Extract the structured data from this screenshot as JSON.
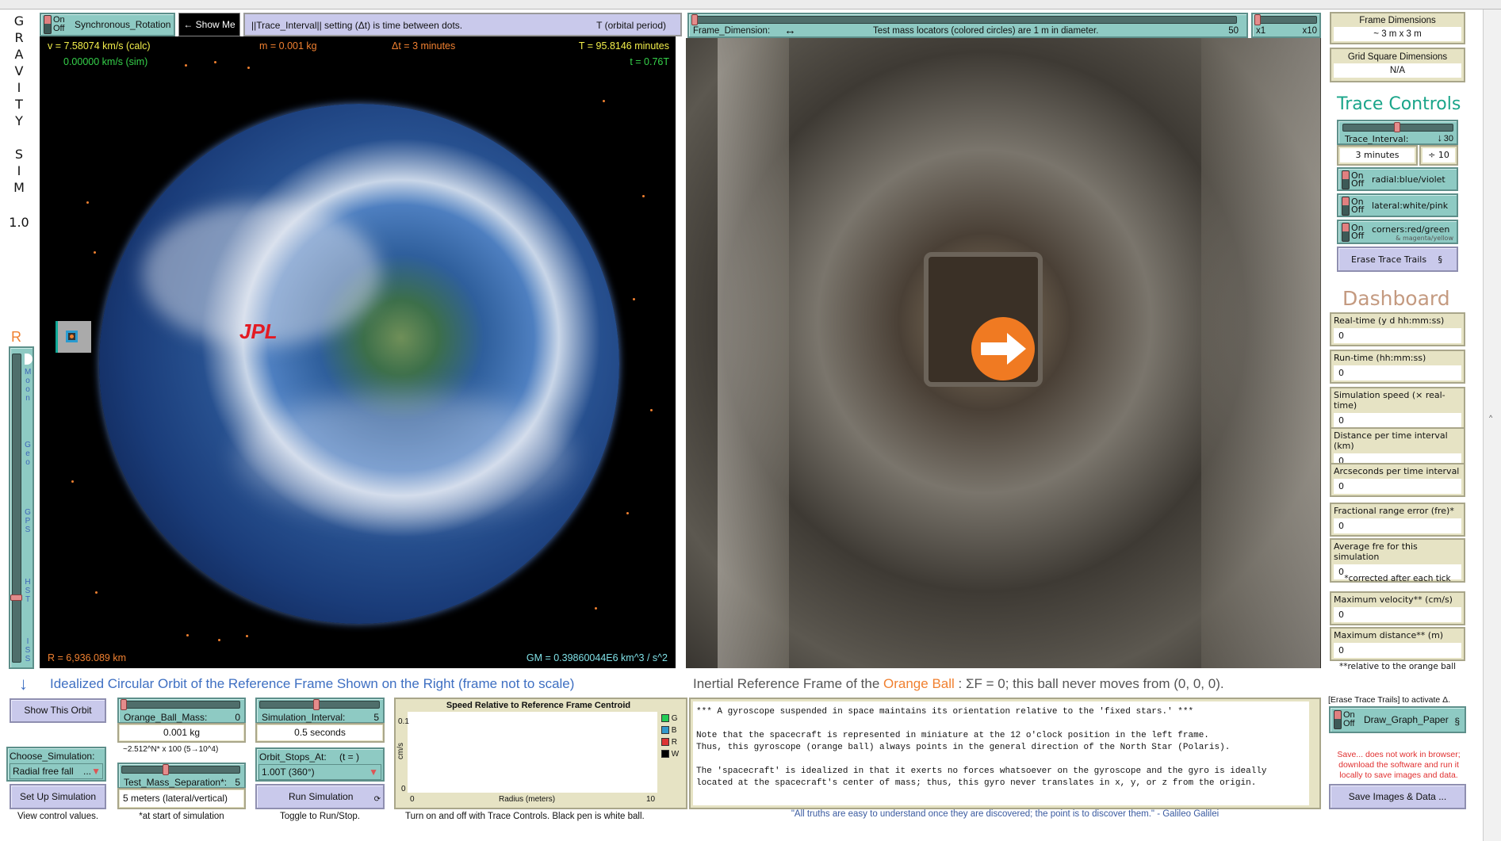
{
  "app_title_letters": [
    "G",
    "R",
    "A",
    "V",
    "I",
    "T",
    "Y",
    "S",
    "I",
    "M"
  ],
  "version": "1.0",
  "radius_label": "R",
  "orbit_slider": {
    "labels": [
      "Moon",
      "Geo",
      "GPS",
      "HST",
      "ISS"
    ],
    "selected": "HST"
  },
  "top_bar": {
    "sync_rotation": {
      "on": "On",
      "off": "Off",
      "label": "Synchronous_Rotation",
      "state": "off"
    },
    "show_me": "← Show Me",
    "trace_note": "||Trace_Interval|| setting (Δt) is time between dots.",
    "period_note": "T (orbital period)"
  },
  "left_frame": {
    "v_calc": "v = 7.58074 km/s (calc)",
    "v_sim": "0.00000 km/s (sim)",
    "mass": "m = 0.001 kg",
    "dt": "Δt = 3 minutes",
    "period": "T = 95.8146 minutes",
    "t": "t = 0.76T",
    "radius": "R = 6,936.089 km",
    "gm": "GM = 0.39860044E6  km^3 / s^2",
    "logo": "JPL"
  },
  "right_top": {
    "frame_dimension_label": "Frame_Dimension:",
    "arrows": "↔",
    "locator_note": "Test mass locators (colored circles) are 1 m in diameter.",
    "frame_value": "50",
    "zoom_min": "x1",
    "zoom_max": "x10"
  },
  "side_panel": {
    "frame_dimensions": {
      "label": "Frame Dimensions",
      "value": "~ 3 m x 3 m"
    },
    "grid_square": {
      "label": "Grid Square Dimensions",
      "value": "N/A"
    },
    "trace_controls_title": "Trace Controls",
    "trace_interval": {
      "label": "Trace_Interval:",
      "value": "30",
      "arrow": "↓",
      "readout": "3 minutes",
      "divisor": "÷ 10"
    },
    "switches": [
      {
        "on": "On",
        "off": "Off",
        "label": "radial:blue/violet",
        "sub": ""
      },
      {
        "on": "On",
        "off": "Off",
        "label": "lateral:white/pink",
        "sub": ""
      },
      {
        "on": "On",
        "off": "Off",
        "label": "corners:red/green",
        "sub": "& magenta/yellow"
      }
    ],
    "erase_button": "Erase Trace Trails",
    "erase_symbol": "§",
    "dashboard_title": "Dashboard",
    "monitors": [
      {
        "label": "Real-time (y d hh:mm:ss)",
        "value": "0"
      },
      {
        "label": "Run-time (hh:mm:ss)",
        "value": "0"
      },
      {
        "label": "Simulation speed (× real-time)",
        "value": "0"
      },
      {
        "label": "Distance per time interval (km)",
        "value": "0"
      },
      {
        "label": "Arcseconds per time interval",
        "value": "0"
      },
      {
        "label": "Fractional range error (fre)*",
        "value": "0"
      },
      {
        "label": "Average fre for this simulation",
        "value": "0"
      },
      {
        "label": "Maximum velocity** (cm/s)",
        "value": "0"
      },
      {
        "label": "Maximum distance** (m)",
        "value": "0"
      }
    ],
    "note_corrected": "*corrected after each tick",
    "note_relative": "**relative to the orange ball"
  },
  "bottom": {
    "orbit_title": "Idealized Circular Orbit of the Reference Frame Shown on the Right (frame not to scale)",
    "frame_title_pre": "Inertial Reference Frame of the",
    "frame_title_ball": "Orange Ball",
    "frame_title_post": ": ΣF = 0; this ball never moves from (0, 0, 0).",
    "show_orbit": "Show This Orbit",
    "choose_sim_label": "Choose_Simulation:",
    "choose_sim_value": "Radial free fall",
    "choose_sim_ellipsis": "...",
    "setup": "Set Up Simulation",
    "caption_view": "View control values.",
    "ball_mass": {
      "label": "Orange_Ball_Mass:",
      "value": "0",
      "readout": "0.001 kg"
    },
    "mass_formula": "~2.512^N* x 100  (5→10^4)",
    "separation": {
      "label": "Test_Mass_Separation*:",
      "value": "5",
      "readout": "5 meters (lateral/vertical)"
    },
    "caption_start": "*at start of simulation",
    "sim_interval": {
      "label": "Simulation_Interval:",
      "value": "5",
      "readout": "0.5 seconds"
    },
    "orbit_stops": {
      "label": "Orbit_Stops_At:",
      "suffix": "(t = )",
      "value": "1.00T (360°)"
    },
    "run": "Run Simulation",
    "run_icon": "⟳",
    "caption_toggle": "Toggle to Run/Stop.",
    "caption_plot": "Turn on and off with Trace Controls. Black pen is white ball.",
    "erase_hint": "[Erase Trace Trails] to activate Δ.",
    "graph_paper": {
      "on": "On",
      "off": "Off",
      "label": "Draw_Graph_Paper",
      "symbol": "§"
    },
    "save_warning": "Save... does not work in browser; download the software and run it locally to save images and data.",
    "save_button": "Save Images & Data ...",
    "info_lines": [
      "*** A gyroscope suspended in space maintains its orientation relative to the 'fixed stars.' ***",
      "",
      "Note that the spacecraft is represented in miniature at the 12 o'clock position in the left frame.",
      "Thus, this gyroscope (orange ball) always points in the general direction of the North Star (Polaris).",
      "",
      "The 'spacecraft' is idealized in that it exerts no forces whatsoever on the gyroscope and the gyro is ideally",
      "located at the spacecraft's center of mass; thus, this gyro never translates in x, y, or z from the origin."
    ],
    "quote": "\"All truths are easy to understand once they are discovered; the point is to discover them.\" - Galileo Galilei"
  },
  "chart_data": {
    "type": "line",
    "title": "Speed Relative to Reference Frame Centroid",
    "xlabel": "Radius (meters)",
    "ylabel": "cm/s",
    "xlim": [
      0,
      10
    ],
    "ylim": [
      0,
      0.1
    ],
    "x_ticks": [
      "0",
      "10"
    ],
    "y_ticks": [
      "0.1",
      "0"
    ],
    "series": [
      {
        "name": "G",
        "color": "#22cc55",
        "values": []
      },
      {
        "name": "B",
        "color": "#3399cc",
        "values": []
      },
      {
        "name": "R",
        "color": "#dd3333",
        "values": []
      },
      {
        "name": "W",
        "color": "#000000",
        "values": []
      }
    ]
  },
  "colors": {
    "teal": "#8ecac3",
    "lavender": "#c9c9eb",
    "beige": "#e6e3c4",
    "trace_title": "#1aa58a",
    "dashboard_title": "#c49a80",
    "orange": "#f08030"
  }
}
